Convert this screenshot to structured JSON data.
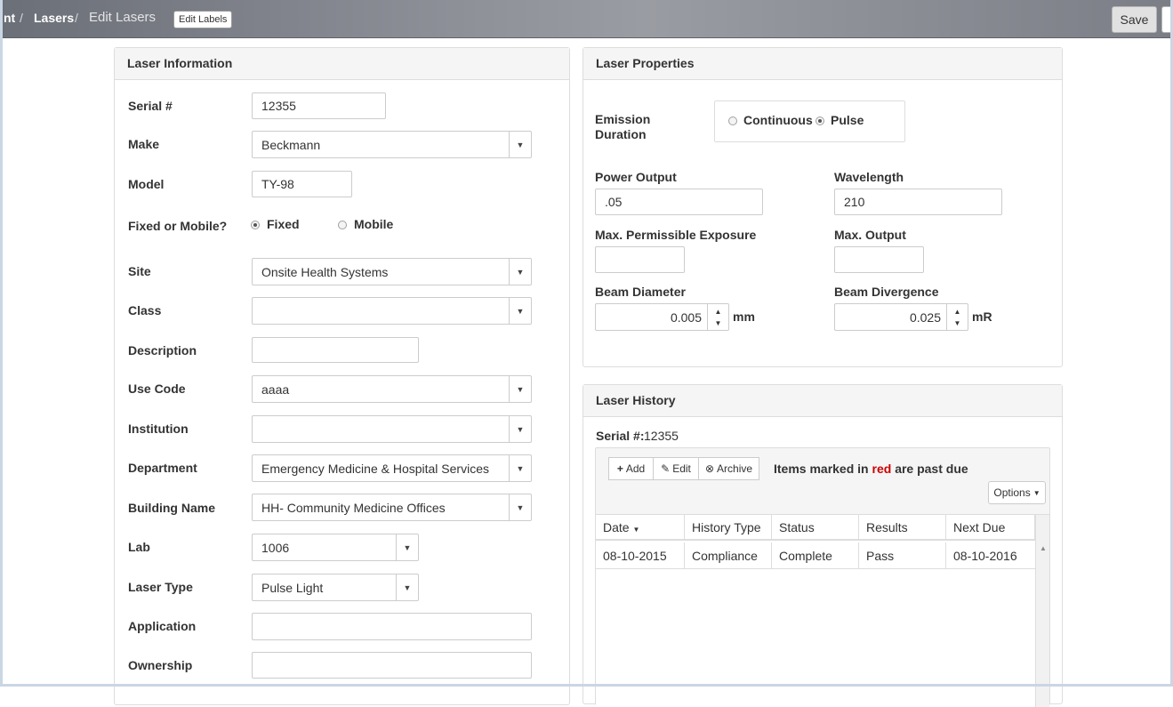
{
  "breadcrumb": {
    "partial": "nt",
    "lasers": "Lasers",
    "current": "Edit Lasers",
    "separator": "/"
  },
  "header": {
    "edit_labels": "Edit Labels",
    "save": "Save"
  },
  "laser_info": {
    "title": "Laser Information",
    "serial_label": "Serial #",
    "serial_value": "12355",
    "make_label": "Make",
    "make_value": "Beckmann",
    "model_label": "Model",
    "model_value": "TY-98",
    "fixed_mobile_label": "Fixed or Mobile?",
    "fixed_label": "Fixed",
    "mobile_label": "Mobile",
    "fixed_mobile_selected": "Fixed",
    "site_label": "Site",
    "site_value": "Onsite Health Systems",
    "class_label": "Class",
    "class_value": "",
    "description_label": "Description",
    "description_value": "",
    "use_code_label": "Use Code",
    "use_code_value": "aaaa",
    "institution_label": "Institution",
    "institution_value": "",
    "department_label": "Department",
    "department_value": "Emergency Medicine & Hospital Services",
    "building_label": "Building Name",
    "building_value": "HH- Community Medicine Offices",
    "lab_label": "Lab",
    "lab_value": "1006",
    "laser_type_label": "Laser Type",
    "laser_type_value": "Pulse Light",
    "application_label": "Application",
    "application_value": "",
    "ownership_label": "Ownership",
    "ownership_value": ""
  },
  "laser_props": {
    "title": "Laser Properties",
    "emission_label_1": "Emission",
    "emission_label_2": "Duration",
    "continuous_label": "Continuous",
    "pulse_label": "Pulse",
    "emission_selected": "Pulse",
    "power_output_label": "Power Output",
    "power_output_value": ".05",
    "wavelength_label": "Wavelength",
    "wavelength_value": "210",
    "mpe_label": "Max. Permissible Exposure",
    "mpe_value": "",
    "max_output_label": "Max. Output",
    "max_output_value": "",
    "beam_diameter_label": "Beam Diameter",
    "beam_diameter_value": "0.005",
    "beam_diameter_unit": "mm",
    "beam_divergence_label": "Beam Divergence",
    "beam_divergence_value": "0.025",
    "beam_divergence_unit": "mR"
  },
  "history": {
    "title": "Laser History",
    "serial_label": "Serial #:",
    "serial_value": "12355",
    "add": "Add",
    "edit": "Edit",
    "archive": "Archive",
    "note_prefix": "Items marked in",
    "note_red": "red",
    "note_suffix": "are past due",
    "options": "Options",
    "columns": [
      "Date",
      "History Type",
      "Status",
      "Results",
      "Next Due"
    ],
    "rows": [
      [
        "08-10-2015",
        "Compliance",
        "Complete",
        "Pass",
        "08-10-2016"
      ]
    ]
  },
  "colors": {
    "past_due": "#cc0000",
    "panel_heading_bg": "#f5f5f5",
    "border": "#cccccc"
  }
}
